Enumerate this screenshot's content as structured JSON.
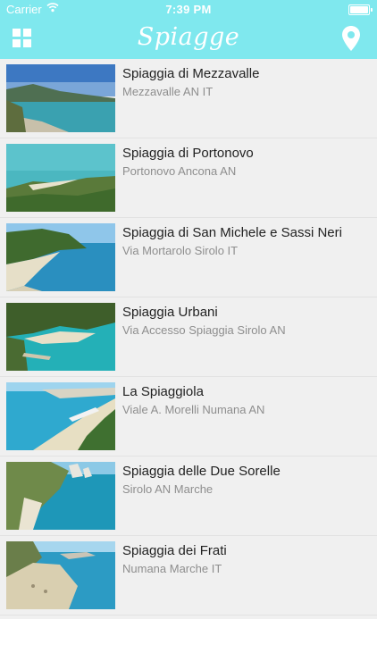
{
  "status_bar": {
    "carrier": "Carrier",
    "time": "7:39 PM"
  },
  "navbar": {
    "title": "Spiagge"
  },
  "beaches": [
    {
      "name": "Spiaggia di Mezzavalle",
      "address": "Mezzavalle AN IT"
    },
    {
      "name": "Spiaggia di Portonovo",
      "address": "Portonovo Ancona AN"
    },
    {
      "name": "Spiaggia di San Michele e Sassi Neri",
      "address": "Via Mortarolo Sirolo IT"
    },
    {
      "name": "Spiaggia Urbani",
      "address": "Via Accesso Spiaggia Sirolo AN"
    },
    {
      "name": "La Spiaggiola",
      "address": "Viale A. Morelli Numana AN"
    },
    {
      "name": "Spiaggia delle Due Sorelle",
      "address": "Sirolo AN Marche"
    },
    {
      "name": "Spiaggia dei Frati",
      "address": "Numana Marche IT"
    }
  ],
  "colors": {
    "navbar": "#7fe8ee",
    "list_background": "#f0f0f0",
    "title_text": "#222222",
    "subtitle_text": "#8e8e8e"
  },
  "icons": {
    "menu": "grid-icon",
    "map": "location-pin-icon",
    "wifi": "wifi-icon",
    "battery": "battery-icon"
  }
}
